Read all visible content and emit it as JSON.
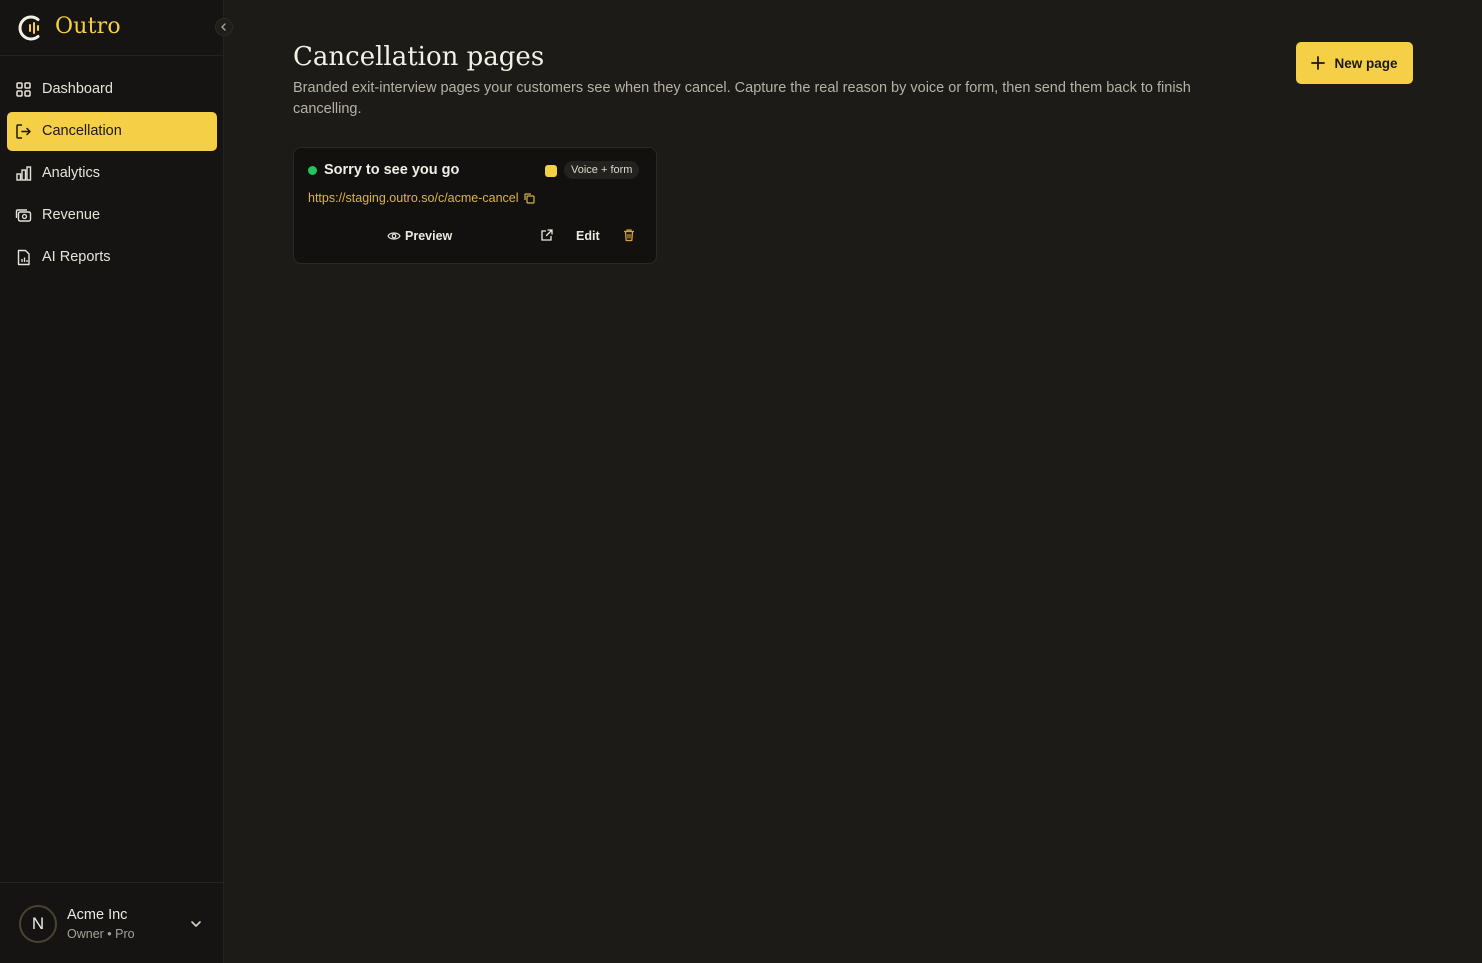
{
  "brand": {
    "name": "Outro",
    "logo_icon": "outro-logo-icon"
  },
  "colors": {
    "accent": "#f5cf45",
    "background": "#1c1b18",
    "sidebar": "#151412",
    "status_active": "#22c55e",
    "link": "#d9b44a"
  },
  "sidebar": {
    "items": [
      {
        "label": "Dashboard",
        "icon": "grid-icon",
        "active": false
      },
      {
        "label": "Cancellation",
        "icon": "exit-icon",
        "active": true
      },
      {
        "label": "Analytics",
        "icon": "bar-chart-icon",
        "active": false
      },
      {
        "label": "Revenue",
        "icon": "money-icon",
        "active": false
      },
      {
        "label": "AI Reports",
        "icon": "report-icon",
        "active": false
      }
    ],
    "account": {
      "initial": "N",
      "name": "Acme Inc",
      "role": "Owner • Pro"
    }
  },
  "main": {
    "title": "Cancellation pages",
    "description": "Branded exit-interview pages your customers see when they cancel. Capture the real reason by voice or form, then send them back to finish cancelling.",
    "new_button_label": "New page",
    "cards": [
      {
        "title": "Sorry to see you go",
        "status": "active",
        "mode": "Voice + form",
        "url": "https://staging.outro.so/c/acme-cancel",
        "preview_label": "Preview",
        "edit_label": "Edit"
      }
    ]
  }
}
